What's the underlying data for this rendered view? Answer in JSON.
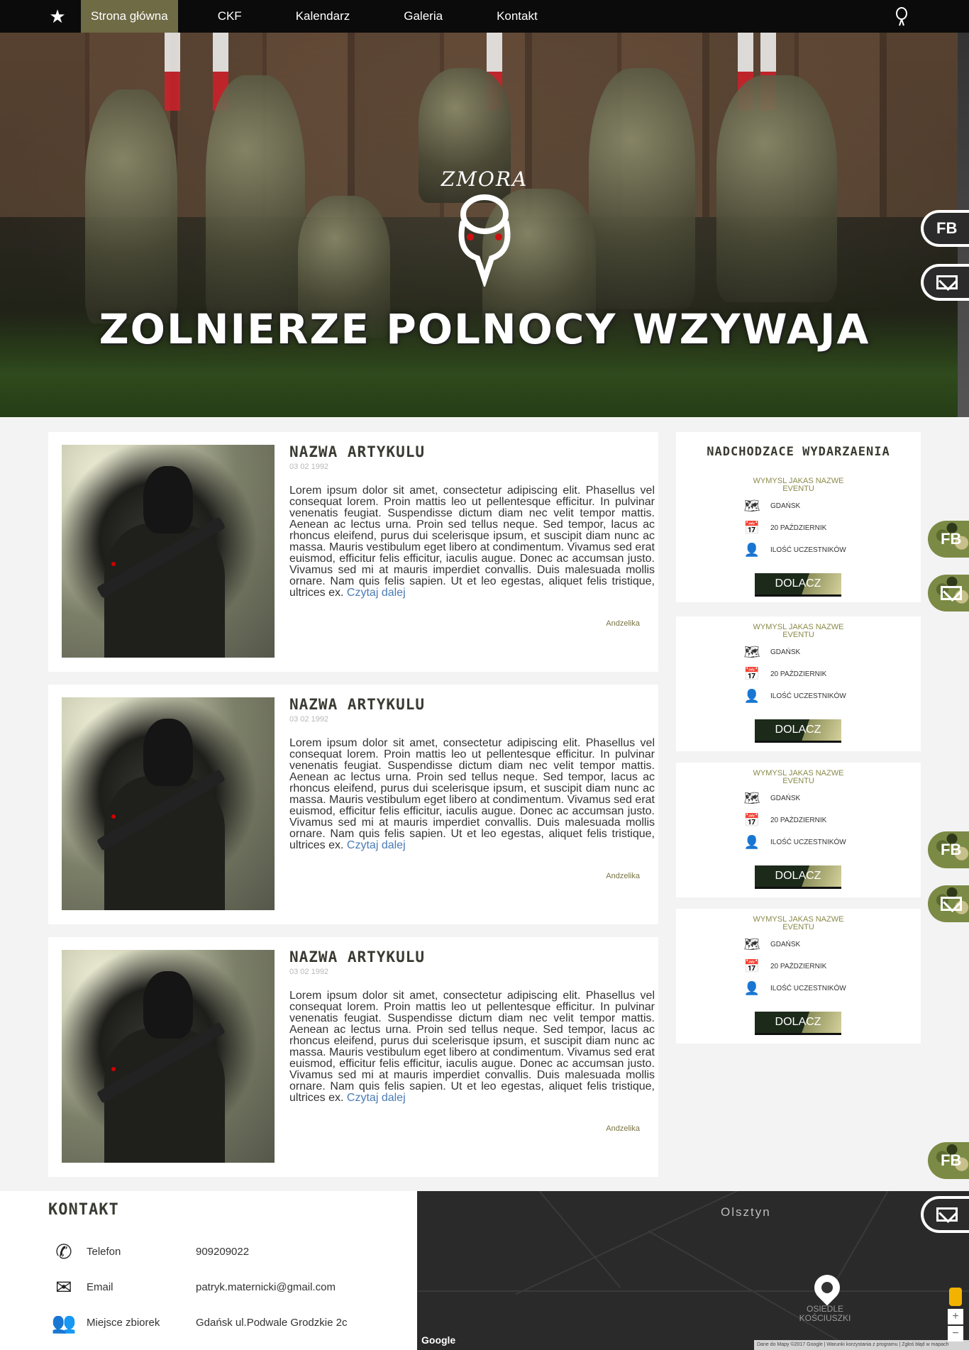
{
  "nav": {
    "items": [
      "Strona główna",
      "CKF",
      "Kalendarz",
      "Galeria",
      "Kontakt"
    ],
    "active": "Strona główna"
  },
  "hero": {
    "emblem_text": "ZMORA",
    "title": "ZOLNIERZE POLNOCY WZYWAJA"
  },
  "social": {
    "fb_label": "FB"
  },
  "articles": [
    {
      "title": "NAZWA ARTYKULU",
      "date": "03 02 1992",
      "body": "Lorem ipsum dolor sit amet, consectetur adipiscing elit. Phasellus vel consequat lorem. Proin mattis leo ut pellentesque efficitur. In pulvinar venenatis feugiat. Suspendisse dictum diam nec velit tempor mattis. Aenean ac lectus urna. Proin sed tellus neque. Sed tempor, lacus ac rhoncus eleifend, purus dui scelerisque ipsum, et suscipit diam nunc ac massa. Mauris vestibulum eget libero at condimentum. Vivamus sed erat euismod, efficitur felis efficitur, iaculis augue. Donec ac accumsan justo. Vivamus sed mi at mauris imperdiet convallis. Duis malesuada mollis ornare. Nam quis felis sapien. Ut et leo egestas, aliquet felis tristique, ultrices ex.",
      "read_more": "Czytaj dalej",
      "author": "Andzelika"
    },
    {
      "title": "NAZWA ARTYKULU",
      "date": "03 02 1992",
      "body": "Lorem ipsum dolor sit amet, consectetur adipiscing elit. Phasellus vel consequat lorem. Proin mattis leo ut pellentesque efficitur. In pulvinar venenatis feugiat. Suspendisse dictum diam nec velit tempor mattis. Aenean ac lectus urna. Proin sed tellus neque. Sed tempor, lacus ac rhoncus eleifend, purus dui scelerisque ipsum, et suscipit diam nunc ac massa. Mauris vestibulum eget libero at condimentum. Vivamus sed erat euismod, efficitur felis efficitur, iaculis augue. Donec ac accumsan justo. Vivamus sed mi at mauris imperdiet convallis. Duis malesuada mollis ornare. Nam quis felis sapien. Ut et leo egestas, aliquet felis tristique, ultrices ex.",
      "read_more": "Czytaj dalej",
      "author": "Andzelika"
    },
    {
      "title": "NAZWA ARTYKULU",
      "date": "03 02 1992",
      "body": "Lorem ipsum dolor sit amet, consectetur adipiscing elit. Phasellus vel consequat lorem. Proin mattis leo ut pellentesque efficitur. In pulvinar venenatis feugiat. Suspendisse dictum diam nec velit tempor mattis. Aenean ac lectus urna. Proin sed tellus neque. Sed tempor, lacus ac rhoncus eleifend, purus dui scelerisque ipsum, et suscipit diam nunc ac massa. Mauris vestibulum eget libero at condimentum. Vivamus sed erat euismod, efficitur felis efficitur, iaculis augue. Donec ac accumsan justo. Vivamus sed mi at mauris imperdiet convallis. Duis malesuada mollis ornare. Nam quis felis sapien. Ut et leo egestas, aliquet felis tristique, ultrices ex.",
      "read_more": "Czytaj dalej",
      "author": "Andzelika"
    }
  ],
  "events": {
    "heading": "NADCHODZACE WYDARZAENIA",
    "items": [
      {
        "name": "WYMYSL JAKAS NAZWE EVENTU",
        "place": "GDAŃSK",
        "date": "20 PAŹDZIERNIK",
        "participants": "ILOŚĆ UCZESTNIKÓW",
        "button": "DOLACZ"
      },
      {
        "name": "WYMYSL JAKAS NAZWE EVENTU",
        "place": "GDAŃSK",
        "date": "20 PAŹDZIERNIK",
        "participants": "ILOŚĆ UCZESTNIKÓW",
        "button": "DOLACZ"
      },
      {
        "name": "WYMYSL JAKAS NAZWE EVENTU",
        "place": "GDAŃSK",
        "date": "20 PAŹDZIERNIK",
        "participants": "ILOŚĆ UCZESTNIKÓW",
        "button": "DOLACZ"
      },
      {
        "name": "WYMYSL JAKAS NAZWE EVENTU",
        "place": "GDAŃSK",
        "date": "20 PAŹDZIERNIK",
        "participants": "ILOŚĆ UCZESTNIKÓW",
        "button": "DOLACZ"
      }
    ]
  },
  "contact": {
    "heading": "KONTAKT",
    "rows": [
      {
        "label": "Telefon",
        "value": "909209022",
        "icon": "phone-icon"
      },
      {
        "label": "Email",
        "value": "patryk.maternicki@gmail.com",
        "icon": "email-icon"
      },
      {
        "label": "Miejsce zbiorek",
        "value": "Gdańsk ul.Podwale Grodzkie 2c",
        "icon": "group-icon"
      }
    ]
  },
  "map": {
    "city": "Olsztyn",
    "marker_label": "OSIEDLE KOŚCIUSZKI",
    "google": "Google",
    "attribution": "Dane do Mapy ©2017 Google | Warunki korzystania z programu | Zgłoś błąd w mapach"
  }
}
